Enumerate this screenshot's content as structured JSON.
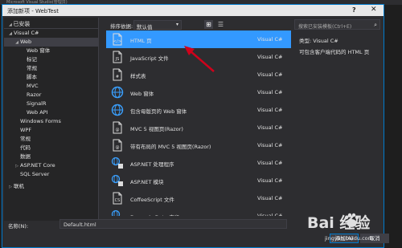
{
  "bg_title": "Microsoft Visual Studio(管理员)",
  "dialog": {
    "title": "添加新项 - WebTest",
    "help": "?",
    "close": "✕"
  },
  "left": {
    "header": "已安装",
    "tree": [
      {
        "label": "Visual C#",
        "arrow": "◢",
        "indent": 0
      },
      {
        "label": "Web",
        "arrow": "◢",
        "indent": 1,
        "selected": true
      },
      {
        "label": "Web 窗体",
        "arrow": "",
        "indent": 2
      },
      {
        "label": "标记",
        "arrow": "",
        "indent": 2
      },
      {
        "label": "常规",
        "arrow": "",
        "indent": 2
      },
      {
        "label": "脚本",
        "arrow": "",
        "indent": 2
      },
      {
        "label": "MVC",
        "arrow": "",
        "indent": 2
      },
      {
        "label": "Razor",
        "arrow": "",
        "indent": 2
      },
      {
        "label": "SignalR",
        "arrow": "",
        "indent": 2
      },
      {
        "label": "Web API",
        "arrow": "",
        "indent": 2
      },
      {
        "label": "Windows Forms",
        "arrow": "",
        "indent": 1
      },
      {
        "label": "WPF",
        "arrow": "",
        "indent": 1
      },
      {
        "label": "常规",
        "arrow": "",
        "indent": 1
      },
      {
        "label": "代码",
        "arrow": "",
        "indent": 1
      },
      {
        "label": "数据",
        "arrow": "",
        "indent": 1
      },
      {
        "label": "ASP.NET Core",
        "arrow": "▷",
        "indent": 1
      },
      {
        "label": "SQL Server",
        "arrow": "",
        "indent": 1
      },
      {
        "label": "联机",
        "arrow": "▷",
        "indent": 0,
        "gap": true
      }
    ]
  },
  "sort": {
    "label": "排序依据:",
    "value": "默认值",
    "chevron": "▾",
    "view_grid": "⊞",
    "view_list": "☰"
  },
  "items": [
    {
      "name": "HTML 页",
      "type": "Visual C#",
      "icon": "html-page-icon",
      "selected": true
    },
    {
      "name": "JavaScript 文件",
      "type": "Visual C#",
      "icon": "javascript-file-icon"
    },
    {
      "name": "样式表",
      "type": "Visual C#",
      "icon": "stylesheet-icon"
    },
    {
      "name": "Web 窗体",
      "type": "Visual C#",
      "icon": "globe-icon"
    },
    {
      "name": "包含母版页的 Web 窗体",
      "type": "Visual C#",
      "icon": "globe-icon"
    },
    {
      "name": "MVC 5 视图页(Razor)",
      "type": "Visual C#",
      "icon": "razor-page-icon"
    },
    {
      "name": "带有布局的 MVC 5 视图页(Razor)",
      "type": "Visual C#",
      "icon": "razor-page-icon"
    },
    {
      "name": "ASP.NET 处理程序",
      "type": "Visual C#",
      "icon": "handler-icon"
    },
    {
      "name": "ASP.NET 模块",
      "type": "Visual C#",
      "icon": "handler-icon"
    },
    {
      "name": "CoffeeScript 文件",
      "type": "Visual C#",
      "icon": "coffeescript-file-icon"
    },
    {
      "name": "Dynamic Data 字段",
      "type": "Visual C#",
      "icon": "dynamic-data-icon"
    }
  ],
  "search": {
    "placeholder": "搜索已安装模板(Ctrl+E)",
    "icon": "⌕"
  },
  "description": {
    "type_line": "类型:  Visual C#",
    "text": "可包含客户端代码的 HTML 页"
  },
  "bottom": {
    "name_label": "名称(N):",
    "name_value": "Default.html",
    "add_button": "添加(A)",
    "cancel_button": "取消"
  },
  "watermark": {
    "brand": "Bai  经验",
    "url": "jingyan.baidu.com"
  },
  "colors": {
    "selection": "#3399ff",
    "accent": "#007acc",
    "annotation_arrow": "#d0021b"
  }
}
